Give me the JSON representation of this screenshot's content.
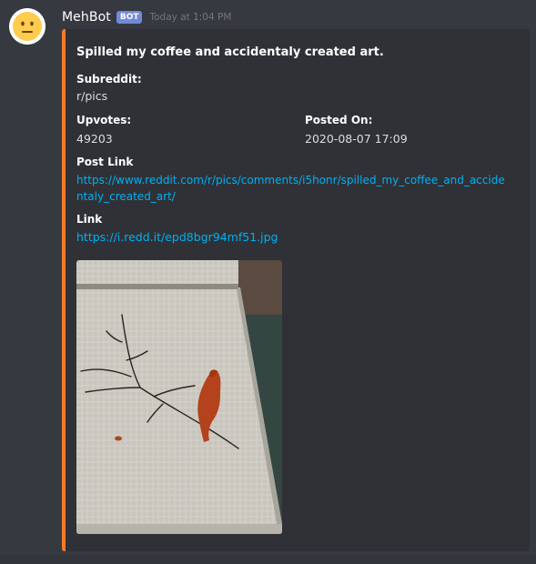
{
  "message": {
    "author": "MehBot",
    "bot_tag": "BOT",
    "timestamp": "Today at 1:04 PM",
    "avatar_icon": "neutral-face-emoji"
  },
  "embed": {
    "accent_color": "#f47b2a",
    "title": "Spilled my coffee and accidentaly created art.",
    "fields": {
      "subreddit": {
        "name": "Subreddit:",
        "value": "r/pics"
      },
      "upvotes": {
        "name": "Upvotes:",
        "value": "49203"
      },
      "posted_on": {
        "name": "Posted On:",
        "value": "2020-08-07 17:09"
      },
      "post_link": {
        "name": "Post Link",
        "value_line1": "https://www.reddit.com/r/pics/comments/i5honr/spilled_my_coffee_and_accide",
        "value_line2": "ntaly_created_art/"
      },
      "link": {
        "name": "Link",
        "value": "https://i.redd.it/epd8bgr94mf51.jpg"
      }
    }
  },
  "colors": {
    "background": "#36393f",
    "embed_background": "#2f3136",
    "link": "#00b0f4",
    "bot_tag": "#7289da",
    "timestamp": "#72767d"
  }
}
